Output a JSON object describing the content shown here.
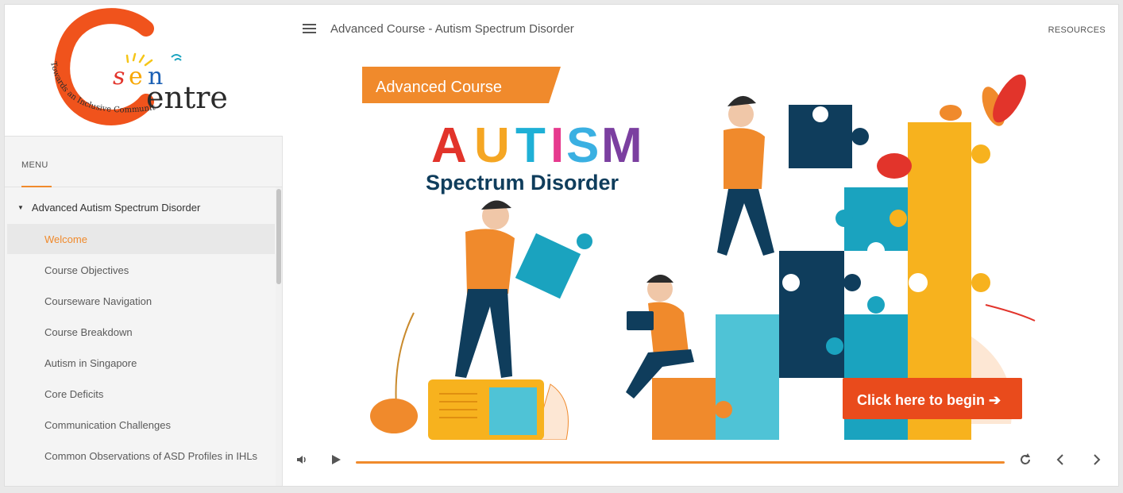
{
  "logo": {
    "letter": "C",
    "sen": "sen",
    "entre": "entre",
    "arc_text": "Towards an Inclusive Community"
  },
  "sidebar": {
    "menu_label": "MENU",
    "parent": "Advanced Autism Spectrum Disorder",
    "items": [
      {
        "label": "Welcome",
        "active": true
      },
      {
        "label": "Course Objectives"
      },
      {
        "label": "Courseware Navigation"
      },
      {
        "label": "Course Breakdown"
      },
      {
        "label": "Autism in Singapore"
      },
      {
        "label": "Core Deficits"
      },
      {
        "label": "Communication Challenges"
      },
      {
        "label": "Common Observations of ASD Profiles in IHLs"
      }
    ]
  },
  "header": {
    "title": "Advanced Course - Autism Spectrum Disorder",
    "resources": "RESOURCES"
  },
  "slide": {
    "banner": "Advanced Course",
    "autism_letters": [
      "A",
      "U",
      "T",
      "I",
      "S",
      "M"
    ],
    "autism_colors": [
      "#e2342b",
      "#f5a623",
      "#1fb0d6",
      "#e63a8e",
      "#3ab0e2",
      "#7b3fa0"
    ],
    "subtitle": "Spectrum Disorder",
    "cta": "Click here to begin ➔"
  },
  "colors": {
    "accent": "#f08a2c",
    "navy": "#0f3d5c",
    "teal": "#1aa3bf",
    "yellow": "#f7b21e"
  },
  "controls": {
    "volume_icon": "volume-icon",
    "play_icon": "play-icon",
    "replay_icon": "replay-icon",
    "prev_icon": "chevron-left-icon",
    "next_icon": "chevron-right-icon",
    "progress": 1.0
  }
}
